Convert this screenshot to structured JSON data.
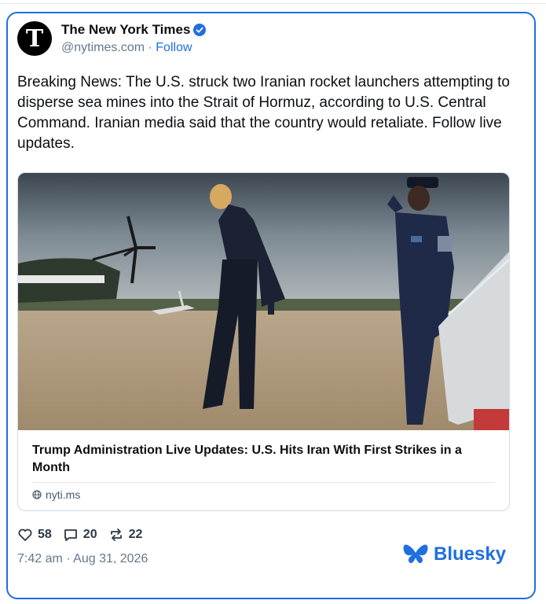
{
  "author": {
    "avatar_glyph": "T",
    "display_name": "The New York Times",
    "handle": "@nytimes.com",
    "separator": "·",
    "follow_label": "Follow",
    "verified_icon": "verified-badge-icon"
  },
  "post": {
    "text": "Breaking News: The U.S. struck two Iranian rocket launchers attempting to disperse sea mines into the Strait of Hormuz, according to U.S. Central Command. Iranian media said that the country would retaliate. Follow live updates."
  },
  "link_card": {
    "image_icon": "news-photo",
    "title": "Trump Administration Live Updates: U.S. Hits Iran With First Strikes in a Month",
    "domain": "nyti.ms",
    "domain_icon": "globe-icon"
  },
  "stats": {
    "likes": "58",
    "replies": "20",
    "reposts": "22"
  },
  "timestamp": "7:42 am · Aug 31, 2026",
  "brand": {
    "name": "Bluesky",
    "color": "#1f6fe0"
  },
  "colors": {
    "accent": "#1f6fe0",
    "muted": "#66788a",
    "text": "#0b0f14"
  }
}
